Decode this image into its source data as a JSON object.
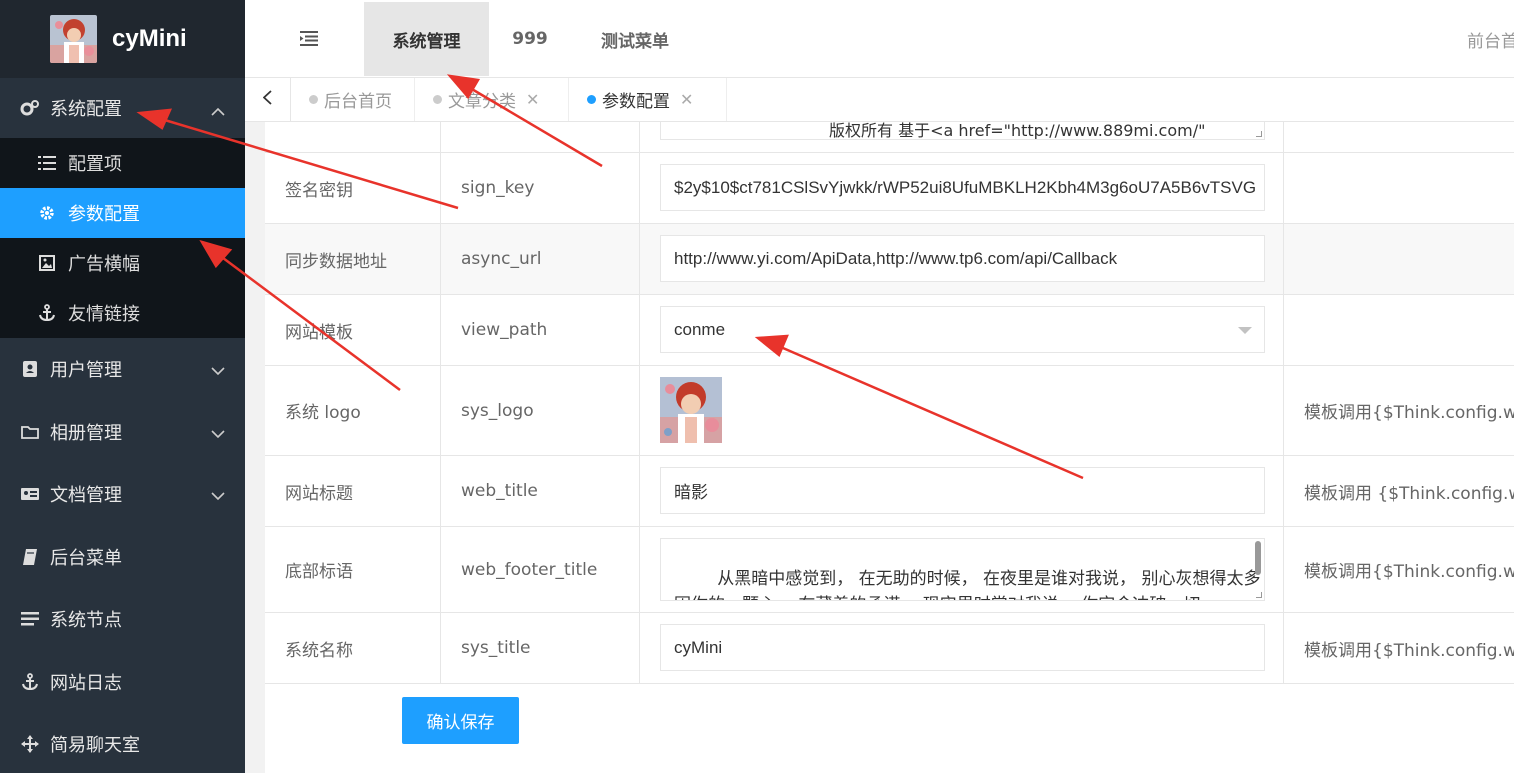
{
  "brand": {
    "name": "cyMini"
  },
  "sidebar": {
    "groups": [
      {
        "label": "系统配置",
        "icon": "gears-icon",
        "expanded": true
      },
      {
        "label": "用户管理",
        "icon": "address-book-icon"
      },
      {
        "label": "相册管理",
        "icon": "folder-icon"
      },
      {
        "label": "文档管理",
        "icon": "id-card-icon"
      },
      {
        "label": "后台菜单",
        "icon": "book-icon"
      },
      {
        "label": "系统节点",
        "icon": "list-icon"
      },
      {
        "label": "网站日志",
        "icon": "anchor-icon"
      },
      {
        "label": "简易聊天室",
        "icon": "move-icon"
      }
    ],
    "submenu": [
      {
        "label": "配置项",
        "icon": "list-ol-icon"
      },
      {
        "label": "参数配置",
        "icon": "gear-icon",
        "active": true
      },
      {
        "label": "广告横幅",
        "icon": "image-icon"
      },
      {
        "label": "友情链接",
        "icon": "anchor-icon"
      }
    ]
  },
  "header": {
    "tabs": [
      "系统管理",
      "999",
      "测试菜单"
    ],
    "active_tab": "系统管理",
    "right_link": "前台首"
  },
  "page_tabs": [
    {
      "label": "后台首页",
      "closable": false
    },
    {
      "label": "文章分类",
      "closable": true
    },
    {
      "label": "参数配置",
      "closable": true,
      "active": true
    }
  ],
  "config": {
    "top_partial": "版权所有  基于<a href=\"http://www.889mi.com/\"",
    "rows": [
      {
        "name": "签名密钥",
        "key": "sign_key",
        "value": "$2y$10$ct781CSlSvYjwkk/rWP52ui8UfuMBKLH2Kbh4M3g6oU7A5B6vTSVG",
        "note": ""
      },
      {
        "name": "同步数据地址",
        "key": "async_url",
        "value": "http://www.yi.com/ApiData,http://www.tp6.com/api/Callback",
        "note": ""
      },
      {
        "name": "网站模板",
        "key": "view_path",
        "value": "conme",
        "note": ""
      },
      {
        "name": "系统 logo",
        "key": "sys_logo",
        "value": "",
        "note": "模板调用{$Think.config.web"
      },
      {
        "name": "网站标题",
        "key": "web_title",
        "value": "暗影",
        "note": "模板调用 {$Think.config.we"
      },
      {
        "name": "底部标语",
        "key": "web_footer_title",
        "value": "从黑暗中感觉到， 在无助的时候， 在夜里是谁对我说， 别心灰想得太多 全\n因你的一颗心， 在藏着的承诺， 现实里时常对我说， 你定会冲破一切，\n全赖你给我一双手臂， 就算在北风中， 你也总没逃避， 全赖你给我一双手，",
        "note": "模板调用{$Think.config.web"
      },
      {
        "name": "系统名称",
        "key": "sys_title",
        "value": "cyMini",
        "note": "模板调用{$Think.config.web"
      }
    ],
    "save_label": "确认保存"
  },
  "colors": {
    "accent": "#1e9fff",
    "sidebar": "#28323d",
    "sidebar_dark": "#10151a",
    "annotation": "#e8332b"
  }
}
